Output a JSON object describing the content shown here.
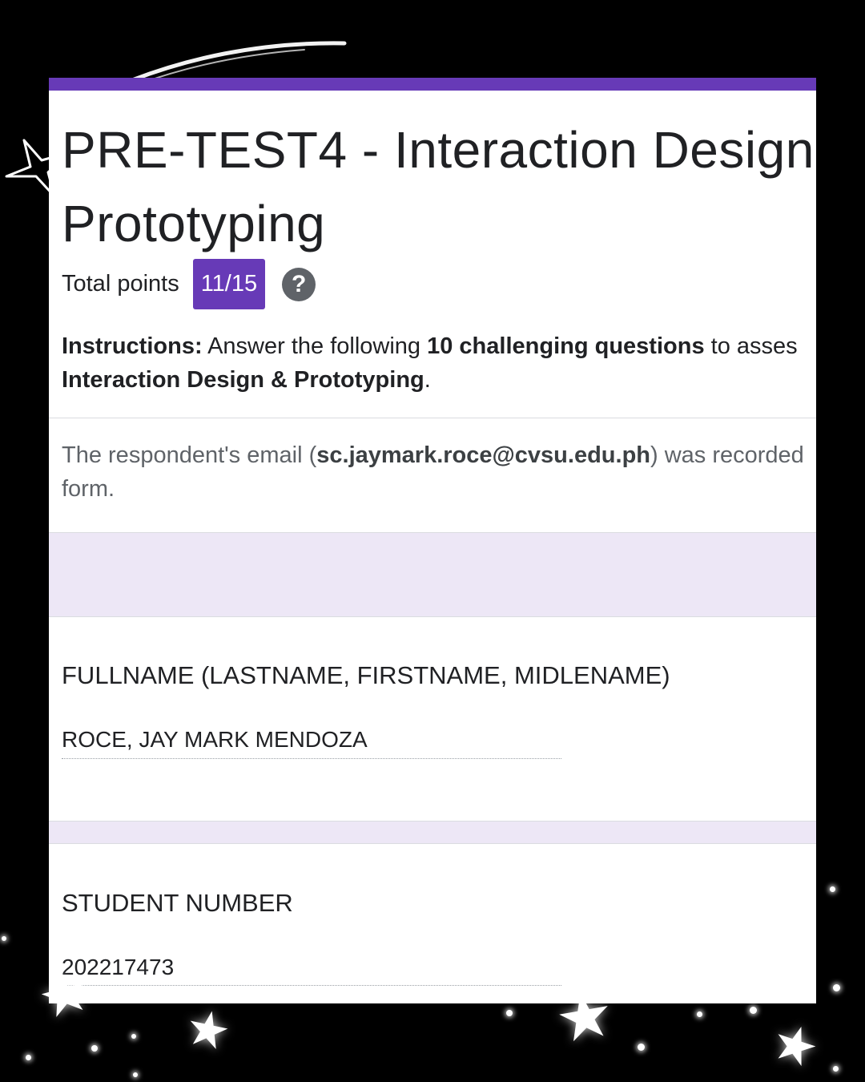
{
  "form": {
    "title_line1": "PRE-TEST4 - Interaction Design",
    "title_line2": "Prototyping",
    "total_points_label": "Total points",
    "total_points_value": "11/15",
    "help_icon_glyph": "?",
    "instructions": {
      "prefix": "Instructions:",
      "text1": " Answer the following ",
      "highlight": "10 challenging questions",
      "text2": " to asses",
      "line2_bold": "Interaction Design & Prototyping",
      "line2_end": "."
    },
    "email_note": {
      "prefix": "The respondent's email (",
      "email": "sc.jaymark.roce@cvsu.edu.ph",
      "suffix": ") was recorded",
      "line2": "form."
    }
  },
  "questions": [
    {
      "title": "FULLNAME (LASTNAME, FIRSTNAME, MIDLENAME)",
      "answer": "ROCE, JAY MARK MENDOZA"
    },
    {
      "title": "STUDENT NUMBER",
      "answer": "202217473"
    }
  ],
  "colors": {
    "accent": "#673ab7",
    "section_band": "#ede7f6",
    "background": "#000000"
  }
}
